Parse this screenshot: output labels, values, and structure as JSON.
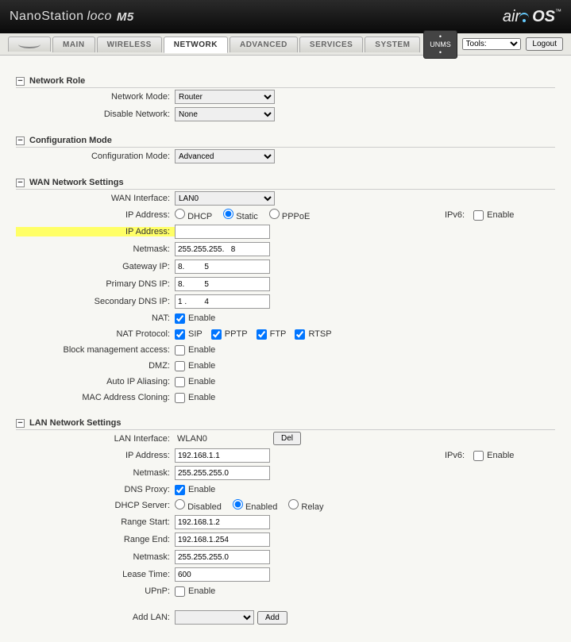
{
  "header": {
    "product": "NanoStation",
    "submodel": "loco",
    "variant": "M5",
    "brand_left": "air",
    "brand_right": "OS",
    "tm": "™"
  },
  "tabs": {
    "main": "MAIN",
    "wireless": "WIRELESS",
    "network": "NETWORK",
    "advanced": "ADVANCED",
    "services": "SERVICES",
    "system": "SYSTEM"
  },
  "topbar": {
    "unms": "• UNMS •",
    "tools": "Tools:",
    "logout": "Logout"
  },
  "sections": {
    "network_role": "Network Role",
    "config_mode": "Configuration Mode",
    "wan": "WAN Network Settings",
    "lan": "LAN Network Settings"
  },
  "network_role": {
    "mode_label": "Network Mode:",
    "mode_value": "Router",
    "disable_label": "Disable Network:",
    "disable_value": "None"
  },
  "config_mode": {
    "label": "Configuration Mode:",
    "value": "Advanced"
  },
  "wan": {
    "iface_label": "WAN Interface:",
    "iface_value": "LAN0",
    "iptype_label": "IP Address:",
    "dhcp": "DHCP",
    "static": "Static",
    "pppoe": "PPPoE",
    "ipv6_label": "IPv6:",
    "enable": "Enable",
    "ip_label": "IP Address:",
    "ip_value": "",
    "netmask_label": "Netmask:",
    "netmask_value": "255.255.255.   8",
    "gateway_label": "Gateway IP:",
    "gateway_value": "8.         5",
    "pdns_label": "Primary DNS IP:",
    "pdns_value": "8.         5",
    "sdns_label": "Secondary DNS IP:",
    "sdns_value": "1 .        4",
    "nat_label": "NAT:",
    "natp_label": "NAT Protocol:",
    "sip": "SIP",
    "pptp": "PPTP",
    "ftp": "FTP",
    "rtsp": "RTSP",
    "block_label": "Block management access:",
    "dmz_label": "DMZ:",
    "autoip_label": "Auto IP Aliasing:",
    "mac_label": "MAC Address Cloning:"
  },
  "lan": {
    "iface_label": "LAN Interface:",
    "iface_value": "WLAN0",
    "del": "Del",
    "ip_label": "IP Address:",
    "ip_value": "192.168.1.1",
    "ipv6_label": "IPv6:",
    "enable": "Enable",
    "netmask_label": "Netmask:",
    "netmask_value": "255.255.255.0",
    "dnsproxy_label": "DNS Proxy:",
    "dhcp_label": "DHCP Server:",
    "disabled": "Disabled",
    "enabled": "Enabled",
    "relay": "Relay",
    "rstart_label": "Range Start:",
    "rstart_value": "192.168.1.2",
    "rend_label": "Range End:",
    "rend_value": "192.168.1.254",
    "netmask2_label": "Netmask:",
    "netmask2_value": "255.255.255.0",
    "lease_label": "Lease Time:",
    "lease_value": "600",
    "upnp_label": "UPnP:",
    "addlan_label": "Add LAN:",
    "add": "Add"
  }
}
